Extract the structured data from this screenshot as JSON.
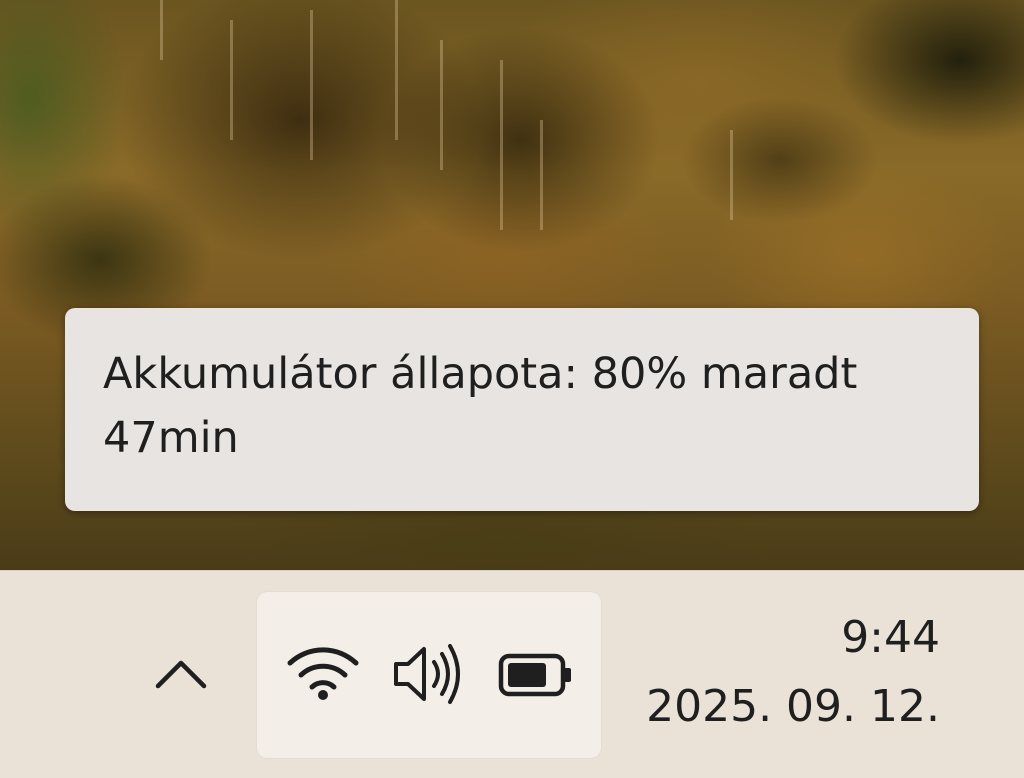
{
  "tooltip": {
    "line1": "Akkumulátor állapota: 80% maradt",
    "line2": "47min"
  },
  "battery": {
    "level_percent": 80
  },
  "tray": {
    "chevron_icon": "chevron-up-icon",
    "wifi_icon": "wifi-icon",
    "volume_icon": "volume-icon",
    "battery_icon": "battery-icon"
  },
  "clock": {
    "time": "9:44",
    "date": "2025. 09. 12."
  },
  "colors": {
    "taskbar_bg": "#eae2d7",
    "tray_group_bg": "#f3eee8",
    "tooltip_bg": "#e7e4e1",
    "icon_color": "#1f1f1f"
  }
}
